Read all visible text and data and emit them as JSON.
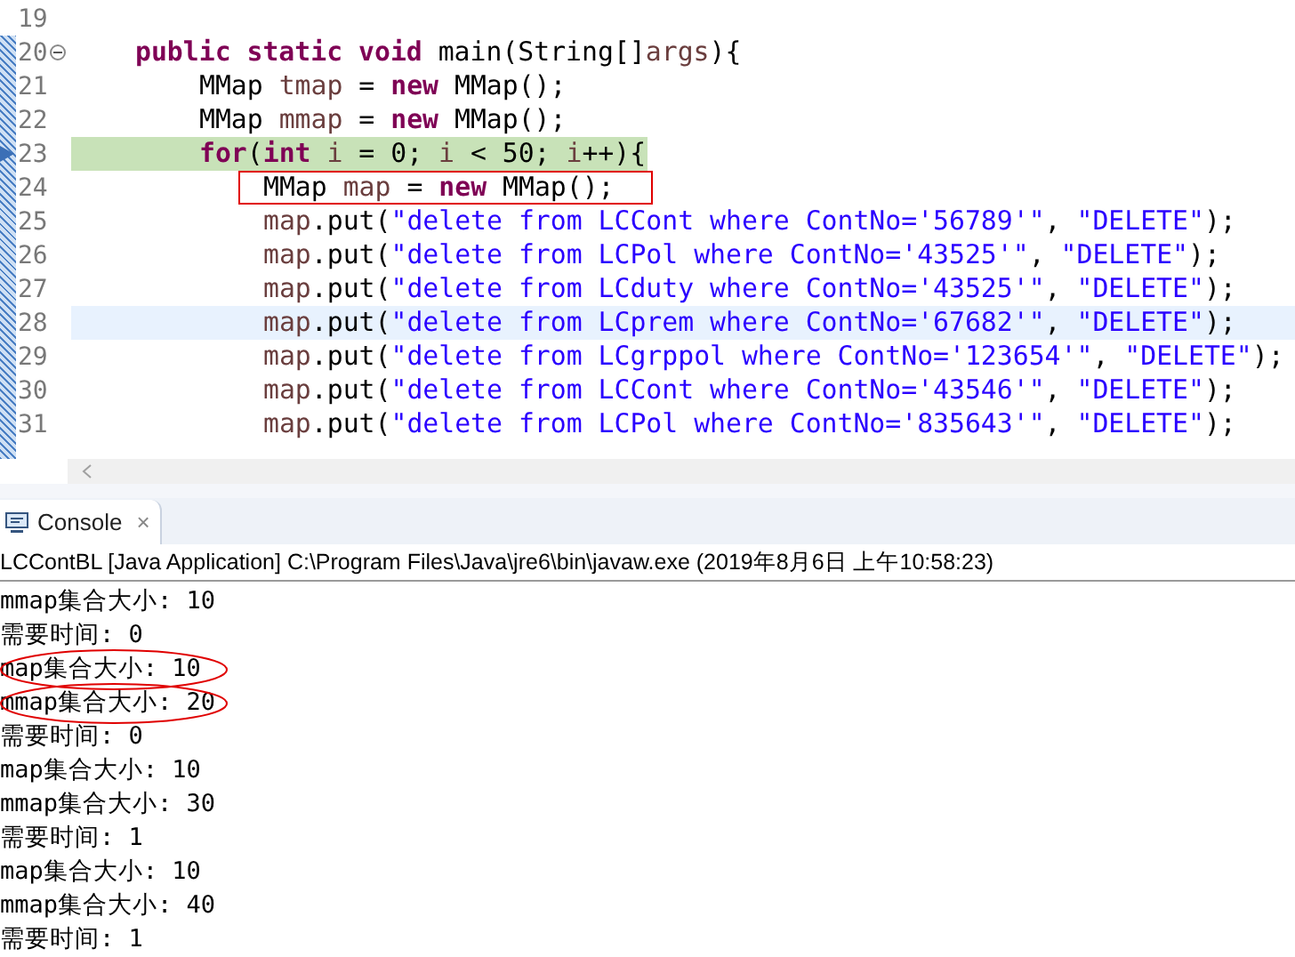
{
  "editor": {
    "lines": [
      {
        "number": "19",
        "kind": "normal",
        "fold": false,
        "boxed": false
      },
      {
        "number": "20",
        "kind": "normal",
        "fold": true,
        "boxed": false,
        "tokens": [
          {
            "kind": "keyword",
            "text": "public static void"
          },
          {
            "kind": "plain",
            "text": " main(String[]"
          },
          {
            "kind": "var",
            "text": "args"
          },
          {
            "kind": "plain",
            "text": "){"
          }
        ],
        "children": [
          {
            "number": "21",
            "kind": "normal",
            "fold": false,
            "boxed": false,
            "tokens": [
              {
                "kind": "plain",
                "text": "MMap "
              },
              {
                "kind": "var",
                "text": "tmap"
              },
              {
                "kind": "plain",
                "text": " = "
              },
              {
                "kind": "keyword",
                "text": "new"
              },
              {
                "kind": "plain",
                "text": " MMap();"
              }
            ]
          },
          {
            "number": "22",
            "kind": "normal",
            "fold": false,
            "boxed": false,
            "tokens": [
              {
                "kind": "plain",
                "text": "MMap "
              },
              {
                "kind": "var",
                "text": "mmap"
              },
              {
                "kind": "plain",
                "text": " = "
              },
              {
                "kind": "keyword",
                "text": "new"
              },
              {
                "kind": "plain",
                "text": " MMap();"
              }
            ]
          },
          {
            "number": "23",
            "kind": "debug",
            "fold": false,
            "boxed": false,
            "tokens": [
              {
                "kind": "keyword",
                "text": "for"
              },
              {
                "kind": "plain",
                "text": "("
              },
              {
                "kind": "keyword",
                "text": "int "
              },
              {
                "kind": "var",
                "text": "i"
              },
              {
                "kind": "plain",
                "text": " = 0; "
              },
              {
                "kind": "var",
                "text": "i"
              },
              {
                "kind": "plain",
                "text": " < 50; "
              },
              {
                "kind": "var",
                "text": "i"
              },
              {
                "kind": "plain",
                "text": "++){"
              }
            ],
            "children": [
              {
                "number": "24",
                "kind": "normal",
                "fold": false,
                "boxed": true,
                "tokens": [
                  {
                    "kind": "plain",
                    "text": "MMap "
                  },
                  {
                    "kind": "var",
                    "text": "map"
                  },
                  {
                    "kind": "plain",
                    "text": " = "
                  },
                  {
                    "kind": "keyword",
                    "text": "new"
                  },
                  {
                    "kind": "plain",
                    "text": " MMap();"
                  }
                ]
              },
              {
                "number": "25",
                "kind": "normal",
                "fold": false,
                "boxed": false,
                "tokens": [
                  {
                    "kind": "var",
                    "text": "map"
                  },
                  {
                    "kind": "plain",
                    "text": ".put("
                  },
                  {
                    "kind": "string",
                    "text": "\"delete from LCCont where ContNo='56789'\""
                  },
                  {
                    "kind": "plain",
                    "text": ", "
                  },
                  {
                    "kind": "string",
                    "text": "\"DELETE\""
                  },
                  {
                    "kind": "plain",
                    "text": ");"
                  }
                ]
              },
              {
                "number": "26",
                "kind": "normal",
                "fold": false,
                "boxed": false,
                "tokens": [
                  {
                    "kind": "var",
                    "text": "map"
                  },
                  {
                    "kind": "plain",
                    "text": ".put("
                  },
                  {
                    "kind": "string",
                    "text": "\"delete from LCPol where ContNo='43525'\""
                  },
                  {
                    "kind": "plain",
                    "text": ", "
                  },
                  {
                    "kind": "string",
                    "text": "\"DELETE\""
                  },
                  {
                    "kind": "plain",
                    "text": ");"
                  }
                ]
              },
              {
                "number": "27",
                "kind": "normal",
                "fold": false,
                "boxed": false,
                "tokens": [
                  {
                    "kind": "var",
                    "text": "map"
                  },
                  {
                    "kind": "plain",
                    "text": ".put("
                  },
                  {
                    "kind": "string",
                    "text": "\"delete from LCduty where ContNo='43525'\""
                  },
                  {
                    "kind": "plain",
                    "text": ", "
                  },
                  {
                    "kind": "string",
                    "text": "\"DELETE\""
                  },
                  {
                    "kind": "plain",
                    "text": ");"
                  }
                ]
              },
              {
                "number": "28",
                "kind": "current",
                "fold": false,
                "boxed": false,
                "tokens": [
                  {
                    "kind": "var",
                    "text": "map"
                  },
                  {
                    "kind": "plain",
                    "text": ".put("
                  },
                  {
                    "kind": "string",
                    "text": "\"delete from LCprem where ContNo='67682'\""
                  },
                  {
                    "kind": "plain",
                    "text": ", "
                  },
                  {
                    "kind": "string",
                    "text": "\"DELETE\""
                  },
                  {
                    "kind": "plain",
                    "text": ");"
                  }
                ]
              },
              {
                "number": "29",
                "kind": "normal",
                "fold": false,
                "boxed": false,
                "tokens": [
                  {
                    "kind": "var",
                    "text": "map"
                  },
                  {
                    "kind": "plain",
                    "text": ".put("
                  },
                  {
                    "kind": "string",
                    "text": "\"delete from LCgrppol where ContNo='123654'\""
                  },
                  {
                    "kind": "plain",
                    "text": ", "
                  },
                  {
                    "kind": "string",
                    "text": "\"DELETE\""
                  },
                  {
                    "kind": "plain",
                    "text": ");"
                  }
                ]
              },
              {
                "number": "30",
                "kind": "normal",
                "fold": false,
                "boxed": false,
                "tokens": [
                  {
                    "kind": "var",
                    "text": "map"
                  },
                  {
                    "kind": "plain",
                    "text": ".put("
                  },
                  {
                    "kind": "string",
                    "text": "\"delete from LCCont where ContNo='43546'\""
                  },
                  {
                    "kind": "plain",
                    "text": ", "
                  },
                  {
                    "kind": "string",
                    "text": "\"DELETE\""
                  },
                  {
                    "kind": "plain",
                    "text": ");"
                  }
                ]
              },
              {
                "number": "31",
                "kind": "normal",
                "fold": false,
                "boxed": false,
                "tokens": [
                  {
                    "kind": "var",
                    "text": "map"
                  },
                  {
                    "kind": "plain",
                    "text": ".put("
                  },
                  {
                    "kind": "string",
                    "text": "\"delete from LCPol where ContNo='835643'\""
                  },
                  {
                    "kind": "plain",
                    "text": ", "
                  },
                  {
                    "kind": "string",
                    "text": "\"DELETE\""
                  },
                  {
                    "kind": "plain",
                    "text": ");"
                  }
                ]
              }
            ]
          }
        ]
      }
    ]
  },
  "console": {
    "tab": {
      "label": "Console",
      "close": "×",
      "selected": true
    },
    "header": "LCContBL [Java Application] C:\\Program Files\\Java\\jre6\\bin\\javaw.exe (2019年8月6日 上午10:58:23)",
    "lines": [
      {
        "text": "mmap集合大小: 10",
        "circled": false
      },
      {
        "text": "需要时间: 0",
        "circled": false
      },
      {
        "text": "map集合大小: 10",
        "circled": true
      },
      {
        "text": "mmap集合大小: 20",
        "circled": true
      },
      {
        "text": "需要时间: 0",
        "circled": false
      },
      {
        "text": "map集合大小: 10",
        "circled": false
      },
      {
        "text": "mmap集合大小: 30",
        "circled": false
      },
      {
        "text": "需要时间: 1",
        "circled": false
      },
      {
        "text": "map集合大小: 10",
        "circled": false
      },
      {
        "text": "mmap集合大小: 40",
        "circled": false
      },
      {
        "text": "需要时间: 1",
        "circled": false
      }
    ]
  }
}
